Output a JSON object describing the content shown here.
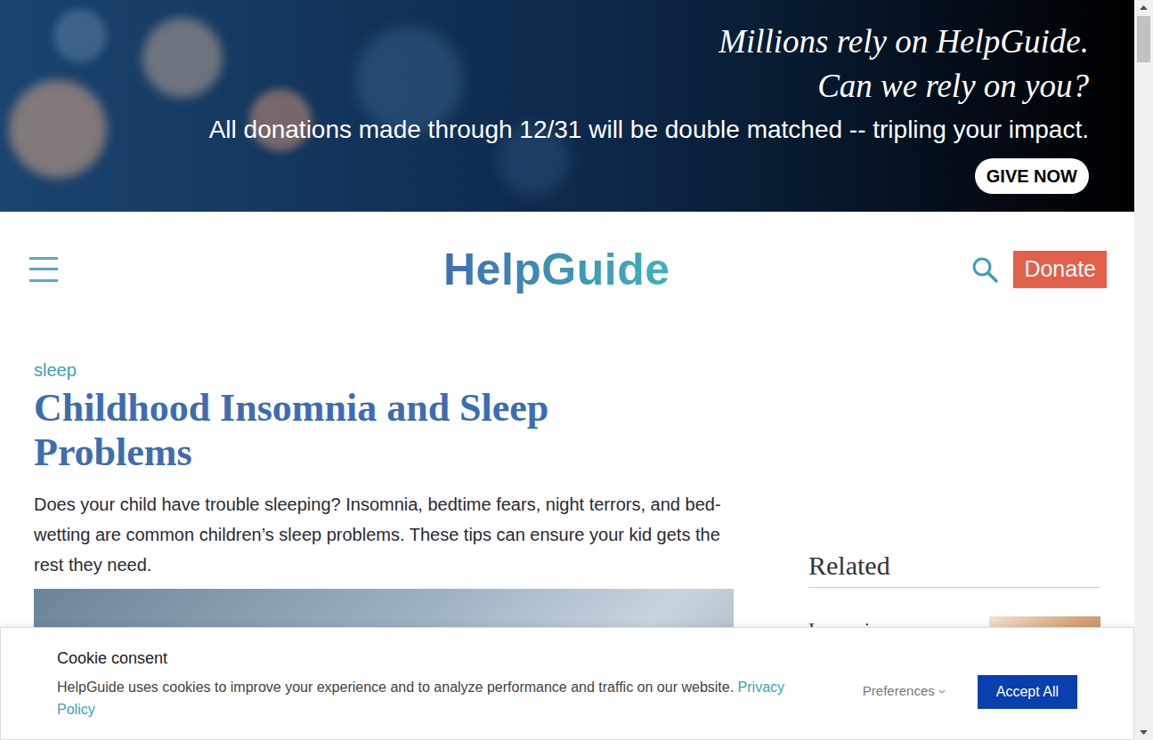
{
  "banner": {
    "headline": [
      "Millions rely on HelpGuide.",
      "Can we rely on you?"
    ],
    "subtext": "All donations made through 12/31 will be double matched -- tripling your impact.",
    "button": "GIVE NOW"
  },
  "header": {
    "logo": "HelpGuide",
    "donate": "Donate"
  },
  "article": {
    "category": "sleep",
    "title": "Childhood Insomnia and Sleep Problems",
    "intro": "Does your child have trouble sleeping? Insomnia, bedtime fears, night terrors, and bed-wetting are common children’s sleep problems. These tips can ensure your kid gets the rest they need."
  },
  "sidebar": {
    "heading": "Related",
    "items": [
      {
        "title": "Insomnia"
      }
    ]
  },
  "cookie": {
    "title": "Cookie consent",
    "text": "HelpGuide uses cookies to improve your experience and to analyze performance and traffic on our website.",
    "link": "Privacy Policy",
    "preferences": "Preferences",
    "accept": "Accept All"
  }
}
